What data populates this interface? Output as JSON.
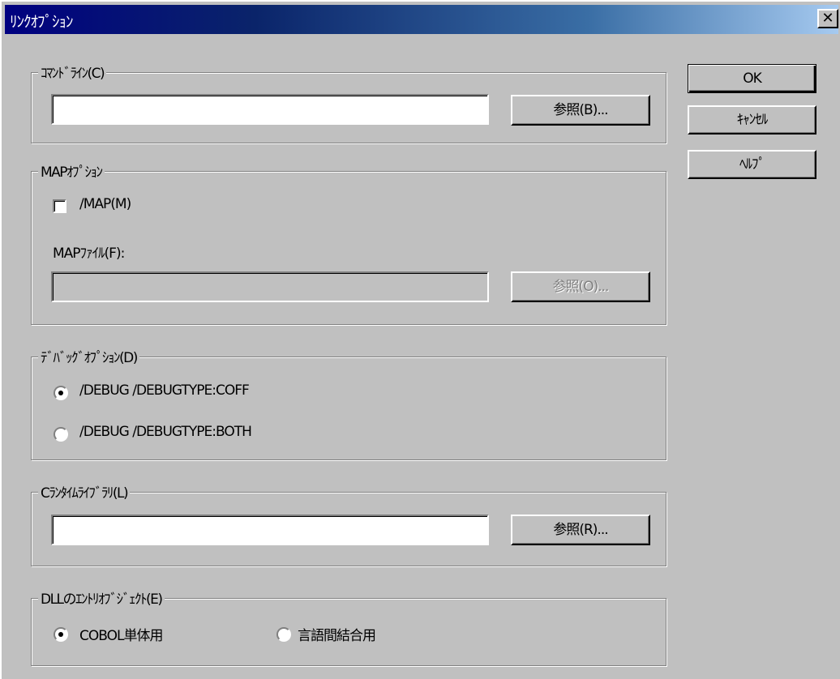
{
  "window": {
    "title": "ﾘﾝｸｵﾌﾟｼｮﾝ",
    "close_glyph": "✕"
  },
  "buttons": {
    "ok": "OK",
    "cancel": "ｷｬﾝｾﾙ",
    "help": "ﾍﾙﾌﾟ"
  },
  "command_line": {
    "label": "ｺﾏﾝﾄﾞﾗｲﾝ(C)",
    "value": "",
    "browse_label": "参照(B)..."
  },
  "map_options": {
    "label": "MAPｵﾌﾟｼｮﾝ",
    "map_checkbox_label": "/MAP(M)",
    "map_checked": false,
    "map_file_label": "MAPﾌｧｲﾙ(F):",
    "map_file_value": "",
    "browse_label": "参照(O)..."
  },
  "debug_options": {
    "label": "ﾃﾞﾊﾞｯｸﾞｵﾌﾟｼｮﾝ(D)",
    "options": [
      "/DEBUG /DEBUGTYPE:COFF",
      "/DEBUG /DEBUGTYPE:BOTH"
    ],
    "selected": 0
  },
  "c_runtime": {
    "label": "Cﾗﾝﾀｲﾑﾗｲﾌﾞﾗﾘ(L)",
    "value": "",
    "browse_label": "参照(R)..."
  },
  "dll_entry": {
    "label": "DLLのｴﾝﾄﾘｵﾌﾞｼﾞｪｸﾄ(E)",
    "options": [
      "COBOL単体用",
      "言語間結合用"
    ],
    "selected": 0
  },
  "colors": {
    "face": "#c0c0c0",
    "title_start": "#000080",
    "title_end": "#a6caf0"
  }
}
